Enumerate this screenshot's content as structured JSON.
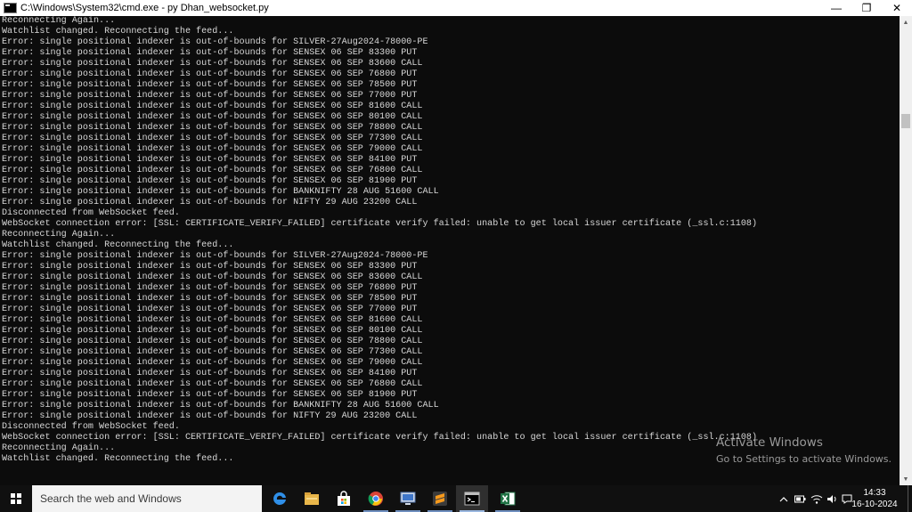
{
  "window": {
    "title": "C:\\Windows\\System32\\cmd.exe - py  Dhan_websocket.py",
    "minimize": "—",
    "maximize": "❐",
    "close": "✕"
  },
  "console_lines": [
    "Reconnecting Again...",
    "Watchlist changed. Reconnecting the feed...",
    "Error: single positional indexer is out-of-bounds for SILVER-27Aug2024-78000-PE",
    "Error: single positional indexer is out-of-bounds for SENSEX 06 SEP 83300 PUT",
    "Error: single positional indexer is out-of-bounds for SENSEX 06 SEP 83600 CALL",
    "Error: single positional indexer is out-of-bounds for SENSEX 06 SEP 76800 PUT",
    "Error: single positional indexer is out-of-bounds for SENSEX 06 SEP 78500 PUT",
    "Error: single positional indexer is out-of-bounds for SENSEX 06 SEP 77000 PUT",
    "Error: single positional indexer is out-of-bounds for SENSEX 06 SEP 81600 CALL",
    "Error: single positional indexer is out-of-bounds for SENSEX 06 SEP 80100 CALL",
    "Error: single positional indexer is out-of-bounds for SENSEX 06 SEP 78800 CALL",
    "Error: single positional indexer is out-of-bounds for SENSEX 06 SEP 77300 CALL",
    "Error: single positional indexer is out-of-bounds for SENSEX 06 SEP 79000 CALL",
    "Error: single positional indexer is out-of-bounds for SENSEX 06 SEP 84100 PUT",
    "Error: single positional indexer is out-of-bounds for SENSEX 06 SEP 76800 CALL",
    "Error: single positional indexer is out-of-bounds for SENSEX 06 SEP 81900 PUT",
    "Error: single positional indexer is out-of-bounds for BANKNIFTY 28 AUG 51600 CALL",
    "Error: single positional indexer is out-of-bounds for NIFTY 29 AUG 23200 CALL",
    "Disconnected from WebSocket feed.",
    "WebSocket connection error: [SSL: CERTIFICATE_VERIFY_FAILED] certificate verify failed: unable to get local issuer certificate (_ssl.c:1108)",
    "Reconnecting Again...",
    "Watchlist changed. Reconnecting the feed...",
    "Error: single positional indexer is out-of-bounds for SILVER-27Aug2024-78000-PE",
    "Error: single positional indexer is out-of-bounds for SENSEX 06 SEP 83300 PUT",
    "Error: single positional indexer is out-of-bounds for SENSEX 06 SEP 83600 CALL",
    "Error: single positional indexer is out-of-bounds for SENSEX 06 SEP 76800 PUT",
    "Error: single positional indexer is out-of-bounds for SENSEX 06 SEP 78500 PUT",
    "Error: single positional indexer is out-of-bounds for SENSEX 06 SEP 77000 PUT",
    "Error: single positional indexer is out-of-bounds for SENSEX 06 SEP 81600 CALL",
    "Error: single positional indexer is out-of-bounds for SENSEX 06 SEP 80100 CALL",
    "Error: single positional indexer is out-of-bounds for SENSEX 06 SEP 78800 CALL",
    "Error: single positional indexer is out-of-bounds for SENSEX 06 SEP 77300 CALL",
    "Error: single positional indexer is out-of-bounds for SENSEX 06 SEP 79000 CALL",
    "Error: single positional indexer is out-of-bounds for SENSEX 06 SEP 84100 PUT",
    "Error: single positional indexer is out-of-bounds for SENSEX 06 SEP 76800 CALL",
    "Error: single positional indexer is out-of-bounds for SENSEX 06 SEP 81900 PUT",
    "Error: single positional indexer is out-of-bounds for BANKNIFTY 28 AUG 51600 CALL",
    "Error: single positional indexer is out-of-bounds for NIFTY 29 AUG 23200 CALL",
    "Disconnected from WebSocket feed.",
    "WebSocket connection error: [SSL: CERTIFICATE_VERIFY_FAILED] certificate verify failed: unable to get local issuer certificate (_ssl.c:1108)",
    "Reconnecting Again...",
    "Watchlist changed. Reconnecting the feed..."
  ],
  "watermark": {
    "title": "Activate Windows",
    "subtitle": "Go to Settings to activate Windows."
  },
  "taskbar": {
    "search_placeholder": "Search the web and Windows",
    "apps": [
      "edge-icon",
      "file-explorer-icon",
      "store-icon",
      "chrome-icon",
      "remote-desktop-icon",
      "sublime-text-icon",
      "command-prompt-icon",
      "excel-icon"
    ],
    "clock_time": "14:33",
    "clock_date": "16-10-2024"
  },
  "colors": {
    "console_bg": "#0c0c0c",
    "console_text": "#d8d8d8",
    "taskbar_bg": "#101010"
  }
}
